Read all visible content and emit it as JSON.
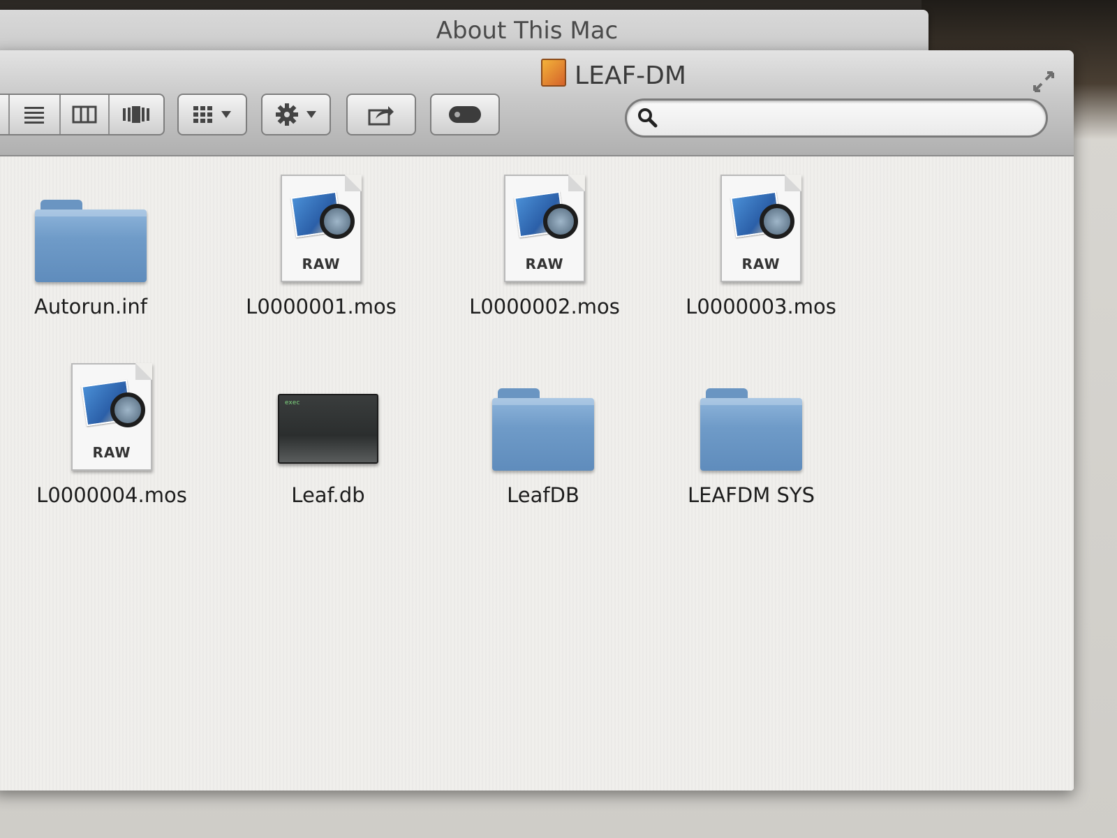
{
  "background_window": {
    "title": "About This Mac"
  },
  "window": {
    "title": "LEAF-DM"
  },
  "toolbar": {
    "view_icons": [
      "list-view-icon",
      "column-view-icon",
      "cover-flow-view-icon"
    ],
    "arrange_icon": "arrange-grid-icon",
    "action_icon": "gear-icon",
    "share_icon": "share-icon",
    "toggle_icon": "toggle-icon",
    "search_placeholder": ""
  },
  "files": [
    {
      "name": "Autorun.inf",
      "kind": "folder"
    },
    {
      "name": "L0000001.mos",
      "kind": "raw",
      "badge": "RAW"
    },
    {
      "name": "L0000002.mos",
      "kind": "raw",
      "badge": "RAW"
    },
    {
      "name": "L0000003.mos",
      "kind": "raw",
      "badge": "RAW"
    },
    {
      "name": "L0000004.mos",
      "kind": "raw",
      "badge": "RAW"
    },
    {
      "name": "Leaf.db",
      "kind": "executable"
    },
    {
      "name": "LeafDB",
      "kind": "folder"
    },
    {
      "name": "LEAFDM SYS",
      "kind": "folder"
    }
  ],
  "colors": {
    "folder_blue": "#6f9bc8",
    "titlebar": "#c9c9c9",
    "content_bg": "#f0efec"
  }
}
